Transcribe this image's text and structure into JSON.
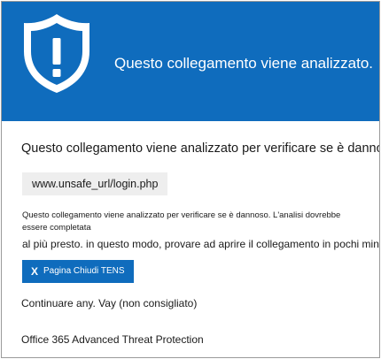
{
  "banner": {
    "title": "Questo collegamento viene analizzato.",
    "icon": "shield-warning-icon",
    "color": "#0f6cbd"
  },
  "main": {
    "headline": "Questo collegamento viene analizzato per verificare se è dannoso.",
    "url": "www.unsafe_url/login.php",
    "detail_line1": "Questo collegamento viene analizzato per verificare se è dannoso. L'analisi dovrebbe essere completata",
    "detail_line2": "al più presto. in questo modo, provare ad aprire il collegamento in pochi minuti.",
    "close_button_icon": "X",
    "close_button_label": "Pagina Chiudi TENS",
    "continue_link": "Continuare any. Vay (non consigliato)",
    "product_name": "Office 365 Advanced Threat Protection"
  }
}
